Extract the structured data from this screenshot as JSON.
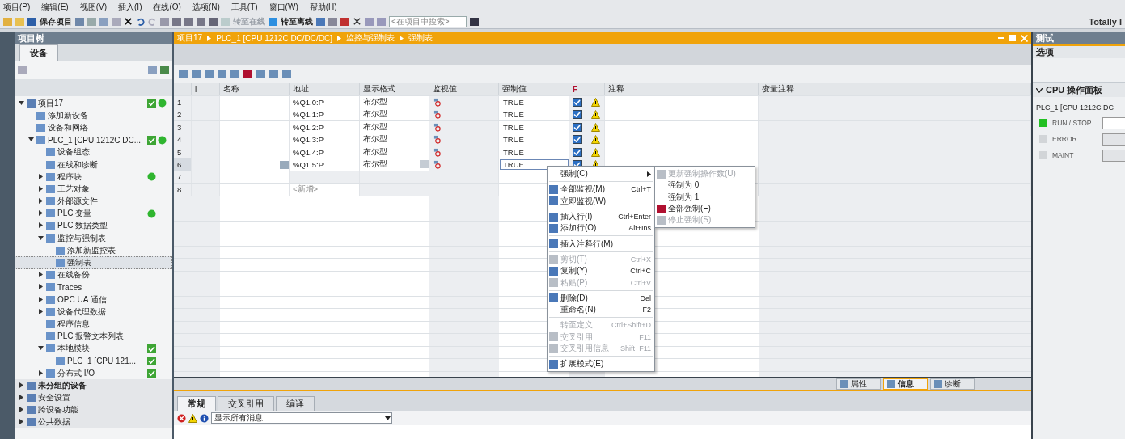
{
  "menu_bar": [
    "项目(P)",
    "编辑(E)",
    "视图(V)",
    "插入(I)",
    "在线(O)",
    "选项(N)",
    "工具(T)",
    "窗口(W)",
    "帮助(H)"
  ],
  "toolbar": {
    "save_label": "保存项目",
    "online": {
      "label": "转至在线",
      "disabled": true
    },
    "offline": {
      "label": "转至离线",
      "disabled": false
    },
    "search": {
      "placeholder": "<在项目中搜索>"
    }
  },
  "brand": "Totally I",
  "project_tree": {
    "title": "项目树",
    "tabs": [
      {
        "label": "设备",
        "selected": true
      }
    ],
    "items": [
      {
        "label": "项目17",
        "expanded": true,
        "checked": true,
        "online": true,
        "selected": false,
        "children": [
          {
            "label": "添加新设备",
            "selected": false
          },
          {
            "label": "设备和网络",
            "selected": false
          },
          {
            "label": "PLC_1 [CPU 1212C DC...",
            "expanded": true,
            "checked": true,
            "online": true,
            "selected": false,
            "children": [
              {
                "label": "设备组态",
                "selected": false
              },
              {
                "label": "在线和诊断",
                "selected": false
              },
              {
                "label": "程序块",
                "expanded": false,
                "online": true,
                "selected": false
              },
              {
                "label": "工艺对象",
                "expanded": false,
                "selected": false
              },
              {
                "label": "外部源文件",
                "expanded": false,
                "selected": false
              },
              {
                "label": "PLC 变量",
                "expanded": false,
                "online": true,
                "selected": false
              },
              {
                "label": "PLC 数据类型",
                "expanded": false,
                "selected": false
              },
              {
                "label": "监控与强制表",
                "expanded": true,
                "selected": false,
                "children": [
                  {
                    "label": "添加新监控表",
                    "selected": false
                  },
                  {
                    "label": "强制表",
                    "selected": true
                  }
                ]
              },
              {
                "label": "在线备份",
                "expanded": false,
                "selected": false
              },
              {
                "label": "Traces",
                "expanded": false,
                "selected": false
              },
              {
                "label": "OPC UA 通信",
                "expanded": false,
                "selected": false
              },
              {
                "label": "设备代理数据",
                "expanded": false,
                "selected": false
              },
              {
                "label": "程序信息",
                "selected": false
              },
              {
                "label": "PLC 报警文本列表",
                "selected": false
              },
              {
                "label": "本地模块",
                "expanded": true,
                "checked": true,
                "selected": false,
                "children": [
                  {
                    "label": "PLC_1 [CPU 121...",
                    "checked": true,
                    "selected": false
                  }
                ]
              },
              {
                "label": "分布式 I/O",
                "expanded": false,
                "checked": true,
                "selected": false
              }
            ]
          }
        ]
      },
      {
        "label": "未分组的设备",
        "expanded": false,
        "bold": true,
        "selected": false
      },
      {
        "label": "安全设置",
        "expanded": false,
        "selected": false
      },
      {
        "label": "跨设备功能",
        "expanded": false,
        "selected": false
      },
      {
        "label": "公共数据",
        "expanded": false,
        "selected": false
      }
    ]
  },
  "editor": {
    "breadcrumb": [
      "项目17",
      "PLC_1 [CPU 1212C DC/DC/DC]",
      "监控与强制表",
      "强制表"
    ],
    "table": {
      "columns": [
        "i",
        "名称",
        "地址",
        "显示格式",
        "监视值",
        "强制值",
        "F",
        "注释",
        "变量注释"
      ],
      "rows": [
        {
          "number": "1",
          "kind": "variable",
          "address": "%Q1.0:P",
          "format": "布尔型",
          "force_value": "TRUE",
          "force_checked": true,
          "warning": true,
          "selected": false
        },
        {
          "number": "2",
          "kind": "variable",
          "address": "%Q1.1:P",
          "format": "布尔型",
          "force_value": "TRUE",
          "force_checked": true,
          "warning": true,
          "selected": false
        },
        {
          "number": "3",
          "kind": "variable",
          "address": "%Q1.2:P",
          "format": "布尔型",
          "force_value": "TRUE",
          "force_checked": true,
          "warning": true,
          "selected": false
        },
        {
          "number": "4",
          "kind": "variable",
          "address": "%Q1.3:P",
          "format": "布尔型",
          "force_value": "TRUE",
          "force_checked": true,
          "warning": true,
          "selected": false
        },
        {
          "number": "5",
          "kind": "variable",
          "address": "%Q1.4:P",
          "format": "布尔型",
          "force_value": "TRUE",
          "force_checked": true,
          "warning": true,
          "selected": false
        },
        {
          "number": "6",
          "kind": "variable",
          "address": "%Q1.5:P",
          "format": "布尔型",
          "force_value": "TRUE",
          "force_checked": true,
          "warning": true,
          "selected": true
        },
        {
          "number": "7",
          "kind": "empty",
          "selected": false
        },
        {
          "number": "8",
          "kind": "new",
          "address": "<新增>",
          "selected": false
        }
      ]
    },
    "context_menu": {
      "items": [
        {
          "kind": "item",
          "label": "强制(C)",
          "submenu": true,
          "icon": false,
          "disabled": false
        },
        {
          "kind": "separator"
        },
        {
          "kind": "item",
          "label": "全部监视(M)",
          "shortcut": "Ctrl+T",
          "icon": true,
          "disabled": false
        },
        {
          "kind": "item",
          "label": "立即监视(W)",
          "icon": true,
          "disabled": false
        },
        {
          "kind": "separator"
        },
        {
          "kind": "item",
          "label": "插入行(I)",
          "shortcut": "Ctrl+Enter",
          "icon": true,
          "disabled": false
        },
        {
          "kind": "item",
          "label": "添加行(O)",
          "shortcut": "Alt+Ins",
          "icon": true,
          "disabled": false
        },
        {
          "kind": "separator"
        },
        {
          "kind": "item",
          "label": "插入注释行(M)",
          "icon": true,
          "disabled": false
        },
        {
          "kind": "separator"
        },
        {
          "kind": "item",
          "label": "剪切(T)",
          "shortcut": "Ctrl+X",
          "icon": true,
          "disabled": true
        },
        {
          "kind": "item",
          "label": "复制(Y)",
          "shortcut": "Ctrl+C",
          "icon": true,
          "disabled": false
        },
        {
          "kind": "item",
          "label": "粘贴(P)",
          "shortcut": "Ctrl+V",
          "icon": true,
          "disabled": true
        },
        {
          "kind": "separator"
        },
        {
          "kind": "item",
          "label": "删除(D)",
          "shortcut": "Del",
          "icon": true,
          "disabled": false
        },
        {
          "kind": "item",
          "label": "重命名(N)",
          "shortcut": "F2",
          "icon": false,
          "disabled": false
        },
        {
          "kind": "separator"
        },
        {
          "kind": "item",
          "label": "转至定义",
          "shortcut": "Ctrl+Shift+D",
          "icon": false,
          "disabled": true
        },
        {
          "kind": "item",
          "label": "交叉引用",
          "shortcut": "F11",
          "icon": true,
          "disabled": true
        },
        {
          "kind": "item",
          "label": "交叉引用信息",
          "shortcut": "Shift+F11",
          "icon": true,
          "disabled": true
        },
        {
          "kind": "separator"
        },
        {
          "kind": "item",
          "label": "扩展模式(E)",
          "icon": true,
          "disabled": false
        }
      ]
    },
    "submenu": {
      "items": [
        {
          "label": "更新强制操作数(U)",
          "icon": true,
          "disabled": true
        },
        {
          "label": "强制为 0",
          "icon": false,
          "disabled": false
        },
        {
          "label": "强制为 1",
          "icon": false,
          "disabled": false
        },
        {
          "label": "全部强制(F)",
          "icon": true,
          "disabled": false
        },
        {
          "label": "停止强制(S)",
          "icon": true,
          "disabled": true
        }
      ]
    }
  },
  "inspector": {
    "tabs": [
      {
        "label": "属性",
        "selected": false
      },
      {
        "label": "信息",
        "selected": true
      },
      {
        "label": "诊断",
        "selected": false
      }
    ],
    "subtabs": [
      {
        "label": "常规",
        "selected": true
      },
      {
        "label": "交叉引用",
        "selected": false
      },
      {
        "label": "编译",
        "selected": false
      }
    ],
    "filter": {
      "value": "显示所有消息"
    }
  },
  "right_panel": {
    "title": "测试",
    "section": "选项",
    "panel_title": "CPU 操作面板",
    "device": "PLC_1 [CPU 1212C DC",
    "leds": [
      {
        "label": "RUN / STOP",
        "on": true
      },
      {
        "label": "ERROR",
        "on": false
      },
      {
        "label": "MAINT",
        "on": false
      }
    ]
  }
}
